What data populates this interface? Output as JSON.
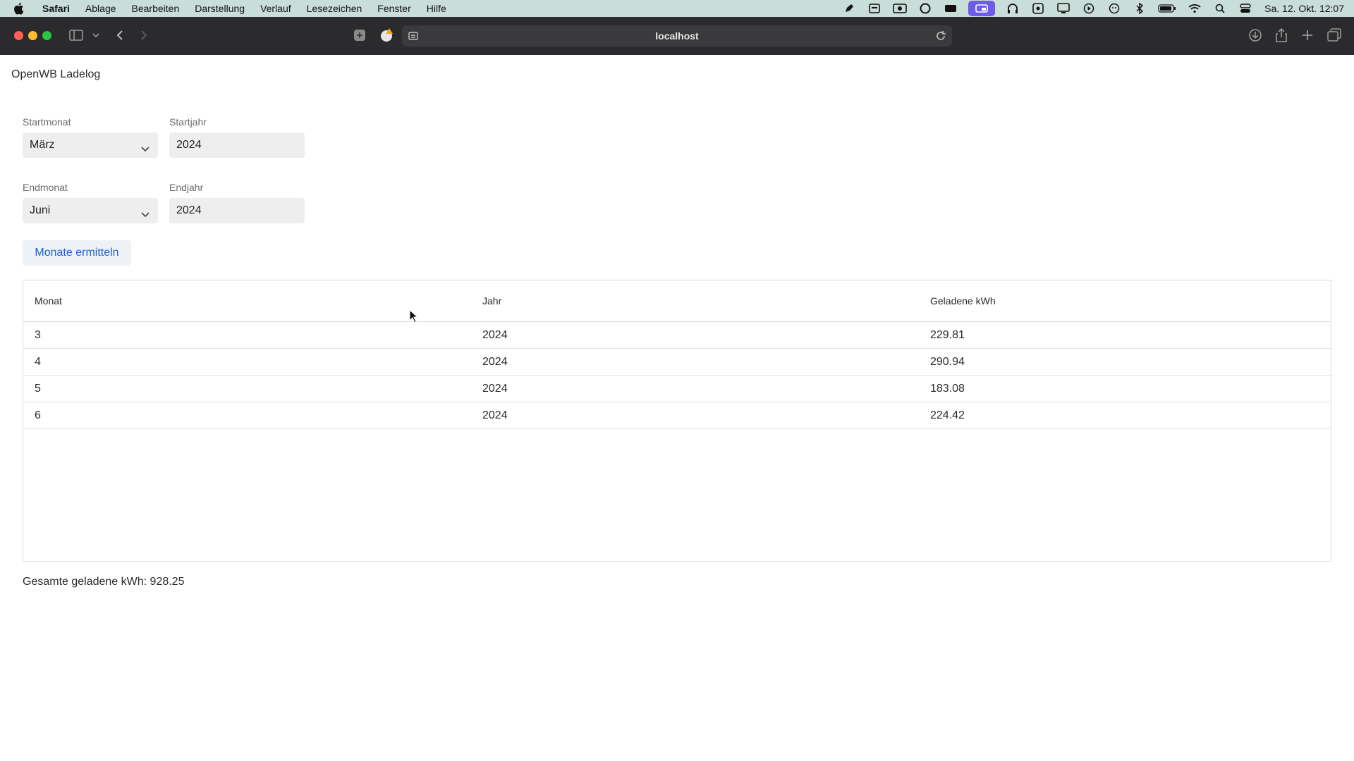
{
  "menubar": {
    "app_name": "Safari",
    "items": [
      "Ablage",
      "Bearbeiten",
      "Darstellung",
      "Verlauf",
      "Lesezeichen",
      "Fenster",
      "Hilfe"
    ],
    "clock": "Sa. 12. Okt. 12:07",
    "status_icons": [
      "pen-icon",
      "keyboard-icon",
      "screen-record-icon",
      "github-icon",
      "battery-box-icon",
      "display-icon",
      "headphones-icon",
      "cast-icon",
      "monitor-icon",
      "play-icon",
      "emoji-icon",
      "bluetooth-icon",
      "battery-icon",
      "wifi-icon",
      "search-icon",
      "control-center-icon"
    ]
  },
  "browser": {
    "url": "localhost"
  },
  "page": {
    "title": "OpenWB Ladelog",
    "start_month": {
      "label": "Startmonat",
      "value": "März"
    },
    "start_year": {
      "label": "Startjahr",
      "value": "2024"
    },
    "end_month": {
      "label": "Endmonat",
      "value": "Juni"
    },
    "end_year": {
      "label": "Endjahr",
      "value": "2024"
    },
    "action_button": "Monate ermitteln",
    "table": {
      "headers": [
        "Monat",
        "Jahr",
        "Geladene kWh"
      ],
      "rows": [
        [
          "3",
          "2024",
          "229.81"
        ],
        [
          "4",
          "2024",
          "290.94"
        ],
        [
          "5",
          "2024",
          "183.08"
        ],
        [
          "6",
          "2024",
          "224.42"
        ]
      ]
    },
    "total": "Gesamte geladene kWh: 928.25"
  },
  "colors": {
    "menubar_bg": "#c9ddd9",
    "toolbar_bg": "#2b2b2d",
    "button_text": "#1f62c9",
    "active_status": "#6d5ce8"
  }
}
